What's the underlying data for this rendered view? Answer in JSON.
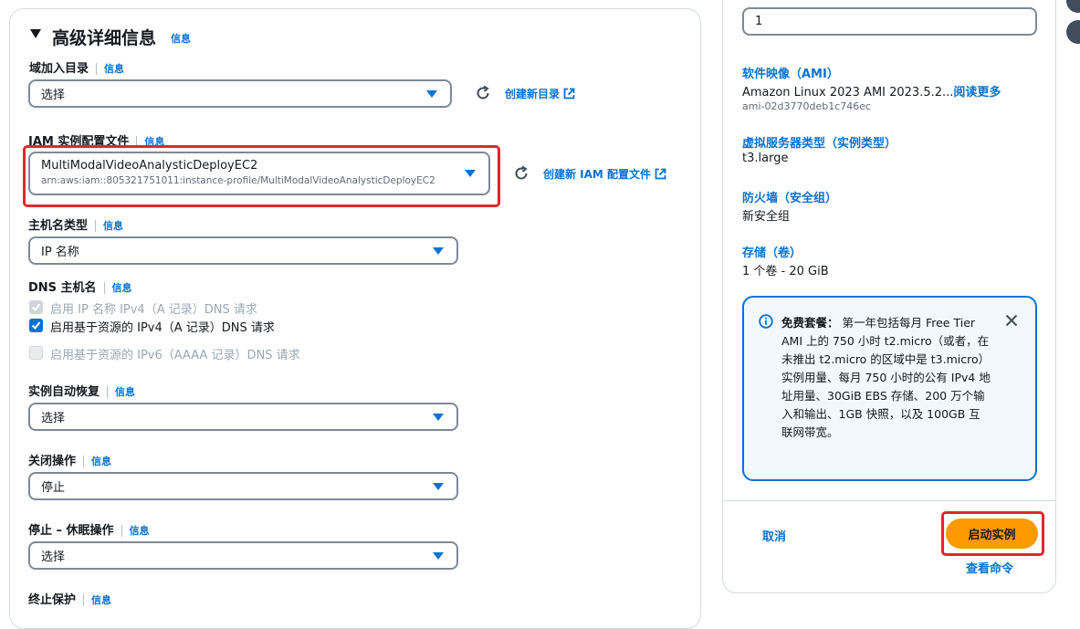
{
  "section": {
    "title": "高级详细信息",
    "info": "信息"
  },
  "domain_join": {
    "label": "域加入目录",
    "info": "信息",
    "value": "选择",
    "create_link": "创建新目录"
  },
  "iam_profile": {
    "label": "IAM 实例配置文件",
    "info": "信息",
    "value": "MultiModalVideoAnalysticDeployEC2",
    "arn": "arn:aws:iam::805321751011:instance-profile/MultiModalVideoAnalysticDeployEC2",
    "create_link": "创建新 IAM 配置文件"
  },
  "hostname_type": {
    "label": "主机名类型",
    "info": "信息",
    "value": "IP 名称"
  },
  "dns_hostname": {
    "label": "DNS 主机名",
    "info": "信息",
    "options": [
      {
        "label": "启用 IP 名称 IPv4（A 记录）DNS 请求",
        "state": "disabled-checked"
      },
      {
        "label": "启用基于资源的 IPv4（A 记录）DNS 请求",
        "state": "checked"
      },
      {
        "label": "启用基于资源的 IPv6（AAAA 记录）DNS 请求",
        "state": "disabled"
      }
    ]
  },
  "auto_recovery": {
    "label": "实例自动恢复",
    "info": "信息",
    "value": "选择"
  },
  "shutdown_behavior": {
    "label": "关闭操作",
    "info": "信息",
    "value": "停止"
  },
  "stop_hibernate": {
    "label": "停止 – 休眠操作",
    "info": "信息",
    "value": "选择"
  },
  "termination_protection": {
    "label": "终止保护",
    "info": "信息"
  },
  "summary": {
    "instance_count": "1",
    "ami_title": "软件映像（AMI）",
    "ami_value": "Amazon Linux 2023 AMI 2023.5.2...",
    "ami_more": "阅读更多",
    "ami_id": "ami-02d3770deb1c746ec",
    "type_title": "虚拟服务器类型（实例类型）",
    "type_value": "t3.large",
    "firewall_title": "防火墙（安全组）",
    "firewall_value": "新安全组",
    "storage_title": "存储（卷）",
    "storage_value": "1 个卷 - 20 GiB"
  },
  "free_tier": {
    "title": "免费套餐：",
    "body": "第一年包括每月 Free Tier AMI 上的 750 小时 t2.micro（或者，在未推出 t2.micro 的区域中是 t3.micro）实例用量、每月 750 小时的公有 IPv4 地址用量、30GiB EBS 存储、200 万个输入和输出、1GB 快照，以及 100GB 互联网带宽。"
  },
  "actions": {
    "cancel": "取消",
    "launch": "启动实例",
    "view_commands": "查看命令"
  },
  "colors": {
    "link": "#0972d3",
    "launch_button": "#ff9900",
    "highlight": "#e0262e"
  }
}
